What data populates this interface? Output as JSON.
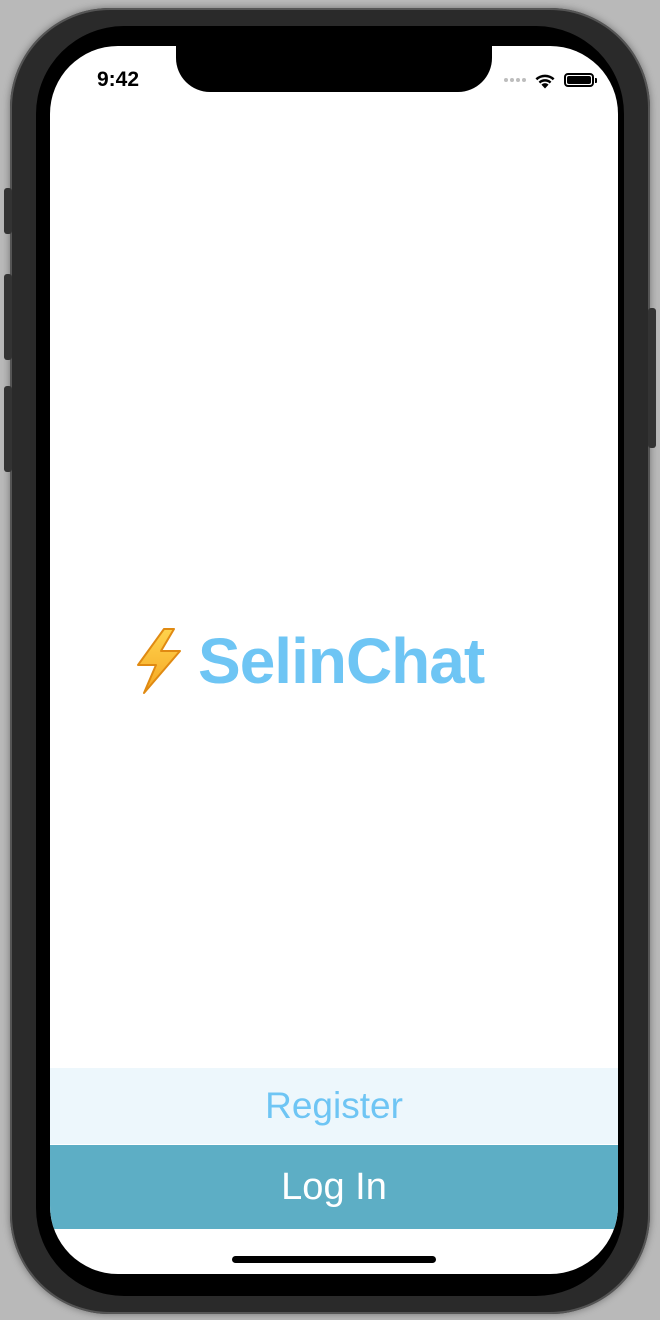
{
  "status_bar": {
    "time": "9:42",
    "icons": [
      "signal-dots-icon",
      "wifi-icon",
      "battery-icon"
    ]
  },
  "logo": {
    "icon": "lightning-bolt-icon",
    "text": "SelinChat"
  },
  "buttons": {
    "register_label": "Register",
    "login_label": "Log In"
  },
  "colors": {
    "brand": "#6ec5f4",
    "register_bg": "#edf7fc",
    "login_bg": "#5daec5"
  }
}
